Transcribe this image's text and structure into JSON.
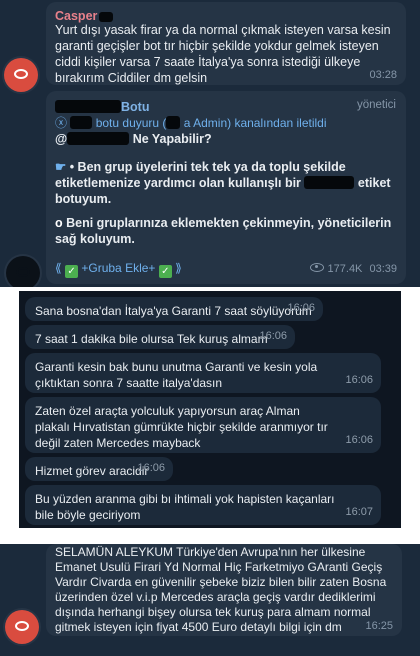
{
  "panel1": {
    "msg1": {
      "sender": "Casper",
      "text": "Yurt dışı yasak firar ya da normal çıkmak isteyen varsa kesin garanti geçişler bot tır hiçbir şekilde yokdur gelmek isteyen ciddi kişiler varsa 7 saate İtalya'ya sonra istediği ülkeye bırakırım Ciddiler dm gelsin",
      "time": "03:28"
    },
    "msg2": {
      "sender": "Botu",
      "admin_label": "yönetici",
      "fwd_prefix": "ⓧ",
      "fwd_botu": "botu duyuru (",
      "fwd_admin": "a Admin) kanalından iletildi",
      "at_prefix": "@",
      "at_suffix": "Ne Yapabilir?",
      "p1a": "• Ben grup üyelerini tek tek ya da toplu şekilde etiketlemenize yardımcı olan kullanışlı bir",
      "p1b": "etiket botuyum.",
      "p2": "Beni gruplarınıza eklemekten çekinmeyin, yöneticilerin sağ koluyum.",
      "cta": "+Gruba Ekle+",
      "views": "177.4K",
      "time": "03:39"
    }
  },
  "panel2": {
    "messages": [
      {
        "text": "Sana bosna'dan İtalya'ya Garanti 7 saat söylüyorum",
        "time": "16:06"
      },
      {
        "text": "7 saat 1 dakika bile olursa Tek kuruş almam",
        "time": "16:06"
      },
      {
        "text": "Garanti kesin bak bunu unutma Garanti ve kesin yola çıktıktan sonra 7 saatte italya'dasın",
        "time": "16:06"
      },
      {
        "text": "Zaten özel araçta yolculuk yapıyorsun araç Alman plakalı Hırvatistan gümrükte hiçbir şekilde aranmıyor tır değil zaten Mercedes mayback",
        "time": "16:06"
      },
      {
        "text": "Hizmet görev aracidir",
        "time": "16:06"
      },
      {
        "text": "Bu yüzden aranma gibi bı ihtimali yok hapisten kaçanları bile böyle geciriyom",
        "time": "16:07"
      }
    ]
  },
  "panel3": {
    "text": "SELAMÜN ALEYKUM Türkiye'den Avrupa'nın her ülkesine Emanet Usulü Firari Yd Normal Hiç Farketmiyo GAranti Geçiş Vardır Civarda en güvenilir şebeke biziz bilen bilir zaten Bosna üzerinden özel v.i.p Mercedes araçla geçiş vardır dediklerimi dışında herhangi bişey olursa tek kuruş para almam normal gitmek isteyen için fiyat 4500 Euro detaylı bilgi için dm",
    "time": "16:25"
  }
}
